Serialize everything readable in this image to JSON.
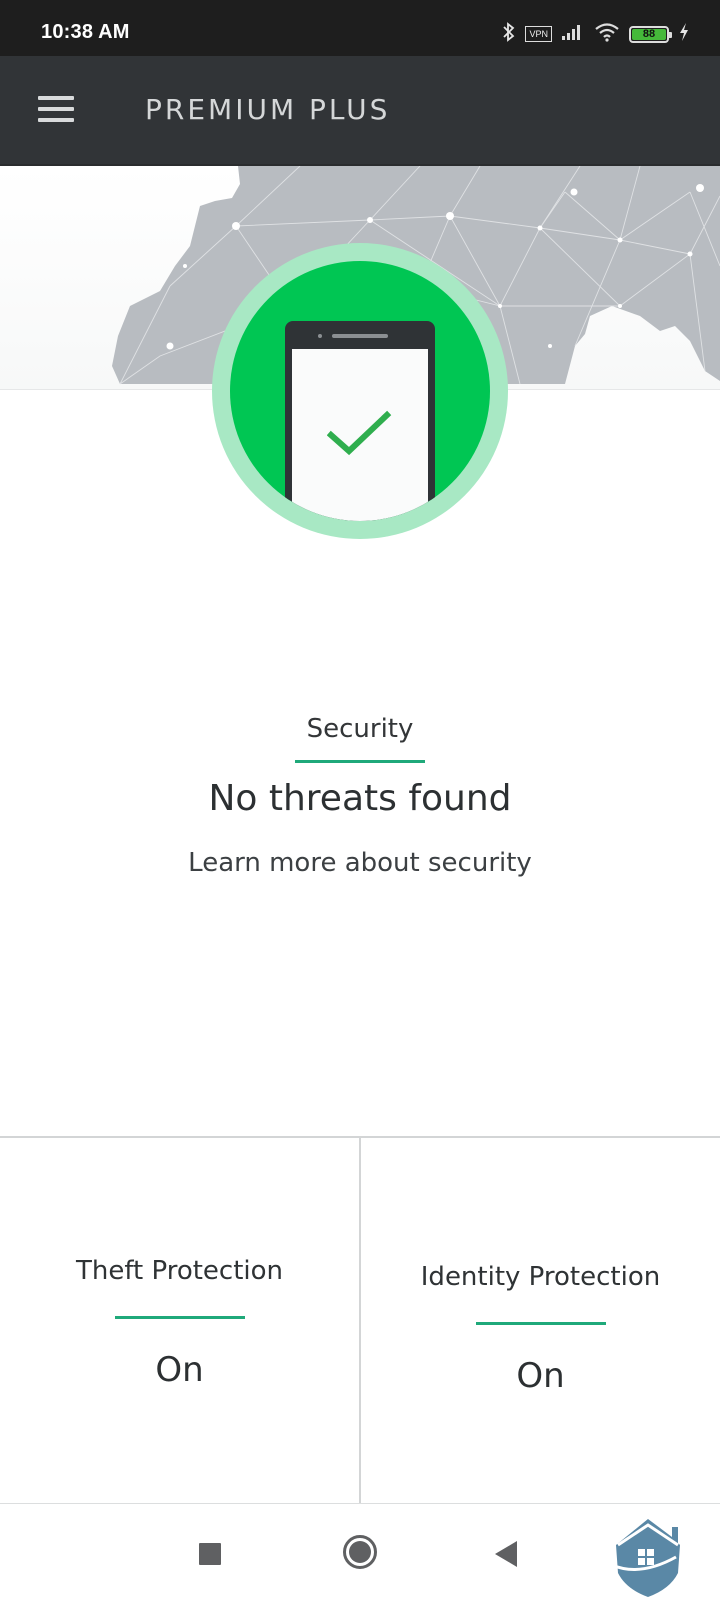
{
  "status_bar": {
    "time": "10:38 AM",
    "icons": [
      "bluetooth-icon",
      "vpn-icon",
      "signal-icon",
      "wifi-icon",
      "battery-icon",
      "charging-icon"
    ],
    "vpn_label": "VPN",
    "battery_level": "88"
  },
  "app_bar": {
    "menu_icon": "hamburger-menu-icon",
    "title": "PREMIUM PLUS"
  },
  "hero": {
    "background": "world-map-network",
    "badge_icon": "phone-check-icon",
    "colors": {
      "ring": "#a8e8c4",
      "core": "#00c653",
      "check": "#2fae4e"
    }
  },
  "security": {
    "label": "Security",
    "status": "No threats found",
    "link": "Learn more about security",
    "accent": "#1fa97a"
  },
  "cards": [
    {
      "title": "Theft Protection",
      "value": "On"
    },
    {
      "title": "Identity Protection",
      "value": "On"
    }
  ],
  "nav_bar": {
    "buttons": [
      "recent-apps",
      "home",
      "back"
    ],
    "watermark": "house-shield-logo"
  }
}
